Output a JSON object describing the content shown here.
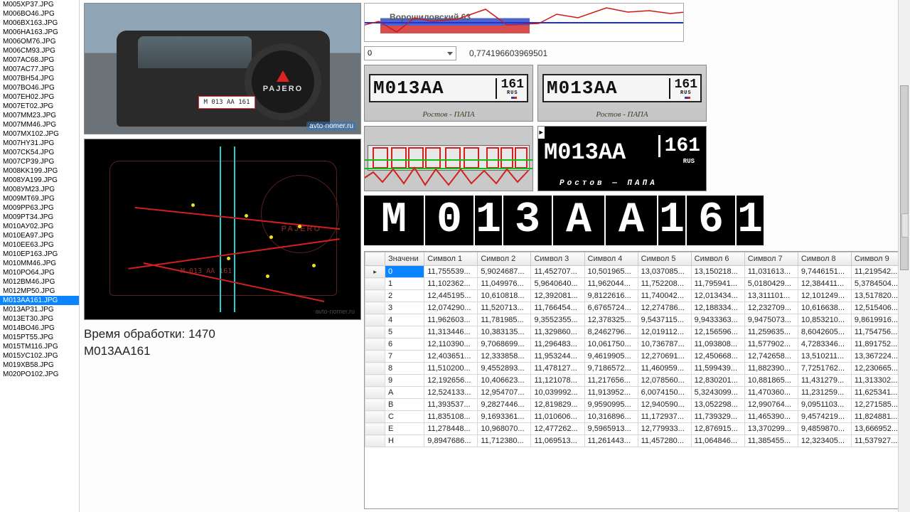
{
  "sidebar": {
    "files": [
      "M005XP37.JPG",
      "M006BO46.JPG",
      "M006BX163.JPG",
      "M006HA163.JPG",
      "M006OM76.JPG",
      "M006CM93.JPG",
      "M007AC68.JPG",
      "M007AC77.JPG",
      "M007BH54.JPG",
      "M007BO46.JPG",
      "M007EH02.JPG",
      "M007ET02.JPG",
      "M007MM23.JPG",
      "M007MM46.JPG",
      "M007MX102.JPG",
      "M007HY31.JPG",
      "M007CK54.JPG",
      "M007CP39.JPG",
      "M008KK199.JPG",
      "M008УA199.JPG",
      "M008УM23.JPG",
      "M009MT69.JPG",
      "M009PP63.JPG",
      "M009PT34.JPG",
      "M010AУ02.JPG",
      "M010EA97.JPG",
      "M010EE63.JPG",
      "M010EP163.JPG",
      "M010MM46.JPG",
      "M010PO64.JPG",
      "M012BM46.JPG",
      "M012MP50.JPG",
      "M013AA161.JPG",
      "M013AP31.JPG",
      "M013ET30.JPG",
      "M014BO46.JPG",
      "M015PT55.JPG",
      "M015TM116.JPG",
      "M015УC102.JPG",
      "M019XB58.JPG",
      "M020PO102.JPG"
    ],
    "selected_index": 32
  },
  "status": {
    "processing_label": "Время обработки: 1470",
    "result_label": "M013AA161"
  },
  "vehicle": {
    "plate_text": "М 013 АА 161",
    "tire_logo_text": "PAJERO",
    "watermark": "avto-nomer.ru"
  },
  "signal": {
    "banner_text": "Ворошиловский 63",
    "spinner_value": "0",
    "float_value": "0,774196603969501"
  },
  "plate_crops": {
    "main_text": "М013АА",
    "region_text": "161",
    "region_sub": "RUS",
    "sticker_text": "Ростов - ПАПА"
  },
  "binarized": {
    "main_text": "M013AA",
    "region_text": "161",
    "region_sub": "RUS",
    "sticker_text": "Ростов — ПАПА"
  },
  "glyphs": [
    "M",
    "0",
    "1",
    "3",
    "A",
    "A",
    "1",
    "6",
    "1"
  ],
  "grid": {
    "headers": [
      "Значени",
      "Символ 1",
      "Символ 2",
      "Символ 3",
      "Символ 4",
      "Символ 5",
      "Символ 6",
      "Символ 7",
      "Символ 8",
      "Символ 9"
    ],
    "rows": [
      {
        "label": "0",
        "cells": [
          "11,755539...",
          "5,9024687...",
          "11,452707...",
          "10,501965...",
          "13,037085...",
          "13,150218...",
          "11,031613...",
          "9,7446151...",
          "11,219542..."
        ]
      },
      {
        "label": "1",
        "cells": [
          "11,102362...",
          "11,049976...",
          "5,9640640...",
          "11,962044...",
          "11,752208...",
          "11,795941...",
          "5,0180429...",
          "12,384411...",
          "5,3784504..."
        ]
      },
      {
        "label": "2",
        "cells": [
          "12,445195...",
          "10,610818...",
          "12,392081...",
          "9,8122616...",
          "11,740042...",
          "12,013434...",
          "13,311101...",
          "12,101249...",
          "13,517820..."
        ]
      },
      {
        "label": "3",
        "cells": [
          "12,074290...",
          "11,520713...",
          "11,766454...",
          "6,6765724...",
          "12,274786...",
          "12,188334...",
          "12,232709...",
          "10,616638...",
          "12,515406..."
        ]
      },
      {
        "label": "4",
        "cells": [
          "11,962603...",
          "11,781985...",
          "9,3552355...",
          "12,378325...",
          "9,5437115...",
          "9,9433363...",
          "9,9475073...",
          "10,853210...",
          "9,8619916..."
        ]
      },
      {
        "label": "5",
        "cells": [
          "11,313446...",
          "10,383135...",
          "11,329860...",
          "8,2462796...",
          "12,019112...",
          "12,156596...",
          "11,259635...",
          "8,6042605...",
          "11,754756..."
        ]
      },
      {
        "label": "6",
        "cells": [
          "12,110390...",
          "9,7068699...",
          "11,296483...",
          "10,061750...",
          "10,736787...",
          "11,093808...",
          "11,577902...",
          "4,7283346...",
          "11,891752..."
        ]
      },
      {
        "label": "7",
        "cells": [
          "12,403651...",
          "12,333858...",
          "11,953244...",
          "9,4619905...",
          "12,270691...",
          "12,450668...",
          "12,742658...",
          "13,510211...",
          "13,367224..."
        ]
      },
      {
        "label": "8",
        "cells": [
          "11,510200...",
          "9,4552893...",
          "11,478127...",
          "9,7186572...",
          "11,460959...",
          "11,599439...",
          "11,882390...",
          "7,7251762...",
          "12,230665..."
        ]
      },
      {
        "label": "9",
        "cells": [
          "12,192656...",
          "10,406623...",
          "11,121078...",
          "11,217656...",
          "12,078560...",
          "12,830201...",
          "10,881865...",
          "11,431279...",
          "11,313302..."
        ]
      },
      {
        "label": "A",
        "cells": [
          "12,524133...",
          "12,954707...",
          "10,039992...",
          "11,913952...",
          "6,0074150...",
          "5,3243099...",
          "11,470360...",
          "11,231259...",
          "11,625341..."
        ]
      },
      {
        "label": "B",
        "cells": [
          "11,393537...",
          "9,2827446...",
          "12,819829...",
          "9,9590995...",
          "12,940590...",
          "13,052298...",
          "12,990764...",
          "9,0951103...",
          "12,271585..."
        ]
      },
      {
        "label": "C",
        "cells": [
          "11,835108...",
          "9,1693361...",
          "11,010606...",
          "10,316896...",
          "11,172937...",
          "11,739329...",
          "11,465390...",
          "9,4574219...",
          "11,824881..."
        ]
      },
      {
        "label": "E",
        "cells": [
          "11,278448...",
          "10,968070...",
          "12,477262...",
          "9,5965913...",
          "12,779933...",
          "12,876915...",
          "13,370299...",
          "9,4859870...",
          "13,666952..."
        ]
      },
      {
        "label": "H",
        "cells": [
          "9,8947686...",
          "11,712380...",
          "11,069513...",
          "11,261443...",
          "11,457280...",
          "11,064846...",
          "11,385455...",
          "12,323405...",
          "11,537927..."
        ]
      }
    ],
    "selected_row": 0,
    "selected_col": 0
  }
}
